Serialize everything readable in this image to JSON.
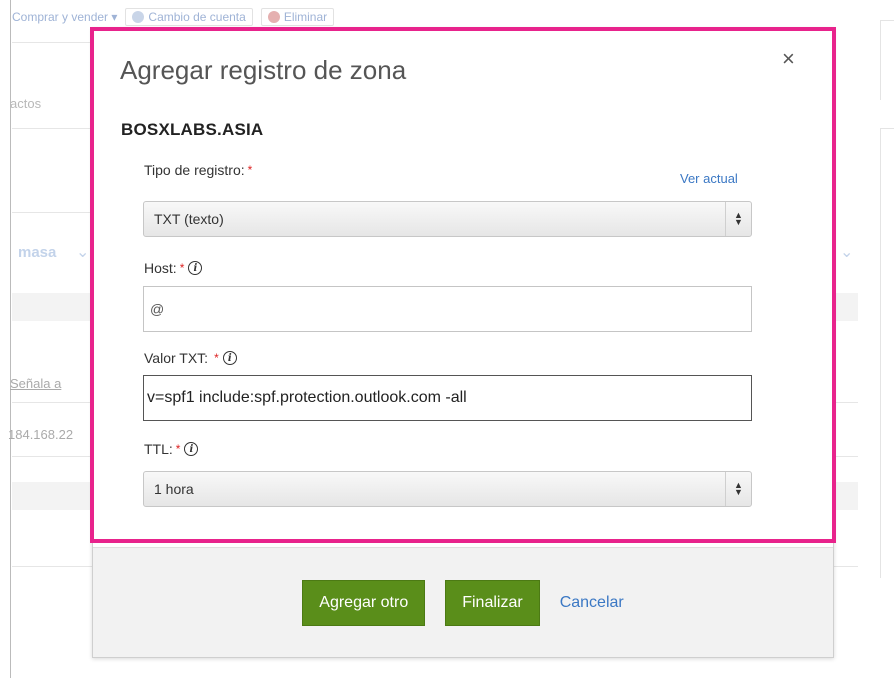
{
  "background": {
    "toolbar": {
      "buy_sell": "Comprar y vender ▾",
      "change_account": "Cambio de cuenta",
      "delete": "Eliminar"
    },
    "contacts_partial": "actos",
    "bulk_partial": "masa",
    "points_to": "Señala a",
    "ip_partial": "184.168.22"
  },
  "modal": {
    "title": "Agregar registro de zona",
    "close": "×",
    "domain": "BOSXLABS.ASIA",
    "record_type": {
      "label": "Tipo de registro:",
      "required": "*",
      "view_current": "Ver actual",
      "selected": "TXT (texto)"
    },
    "host": {
      "label": "Host:",
      "required": "*",
      "value": "@"
    },
    "txt_value": {
      "label": "Valor TXT:",
      "required": "*",
      "value": "v=spf1 include:spf.protection.outlook.com -all"
    },
    "ttl": {
      "label": "TTL:",
      "required": "*",
      "selected": "1 hora"
    },
    "footer": {
      "add_another": "Agregar otro",
      "finish": "Finalizar",
      "cancel": "Cancelar"
    }
  },
  "colors": {
    "highlight": "#e8238c",
    "primary_button": "#5a8e1a",
    "link": "#3b78c4"
  }
}
